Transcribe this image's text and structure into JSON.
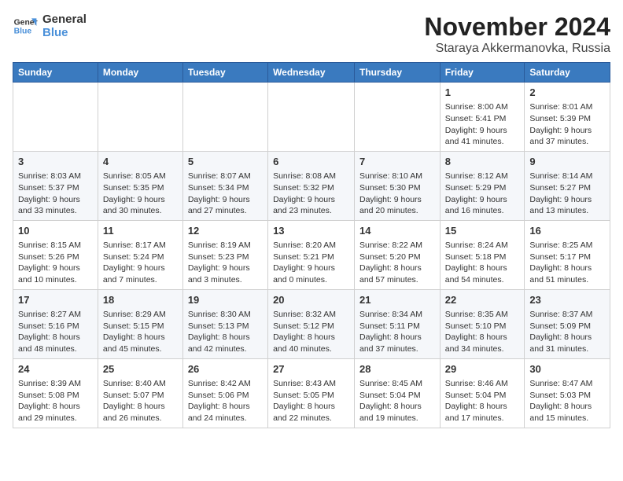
{
  "logo": {
    "line1": "General",
    "line2": "Blue"
  },
  "header": {
    "month": "November 2024",
    "location": "Staraya Akkermanovka, Russia"
  },
  "weekdays": [
    "Sunday",
    "Monday",
    "Tuesday",
    "Wednesday",
    "Thursday",
    "Friday",
    "Saturday"
  ],
  "weeks": [
    [
      {
        "day": "",
        "info": ""
      },
      {
        "day": "",
        "info": ""
      },
      {
        "day": "",
        "info": ""
      },
      {
        "day": "",
        "info": ""
      },
      {
        "day": "",
        "info": ""
      },
      {
        "day": "1",
        "info": "Sunrise: 8:00 AM\nSunset: 5:41 PM\nDaylight: 9 hours\nand 41 minutes."
      },
      {
        "day": "2",
        "info": "Sunrise: 8:01 AM\nSunset: 5:39 PM\nDaylight: 9 hours\nand 37 minutes."
      }
    ],
    [
      {
        "day": "3",
        "info": "Sunrise: 8:03 AM\nSunset: 5:37 PM\nDaylight: 9 hours\nand 33 minutes."
      },
      {
        "day": "4",
        "info": "Sunrise: 8:05 AM\nSunset: 5:35 PM\nDaylight: 9 hours\nand 30 minutes."
      },
      {
        "day": "5",
        "info": "Sunrise: 8:07 AM\nSunset: 5:34 PM\nDaylight: 9 hours\nand 27 minutes."
      },
      {
        "day": "6",
        "info": "Sunrise: 8:08 AM\nSunset: 5:32 PM\nDaylight: 9 hours\nand 23 minutes."
      },
      {
        "day": "7",
        "info": "Sunrise: 8:10 AM\nSunset: 5:30 PM\nDaylight: 9 hours\nand 20 minutes."
      },
      {
        "day": "8",
        "info": "Sunrise: 8:12 AM\nSunset: 5:29 PM\nDaylight: 9 hours\nand 16 minutes."
      },
      {
        "day": "9",
        "info": "Sunrise: 8:14 AM\nSunset: 5:27 PM\nDaylight: 9 hours\nand 13 minutes."
      }
    ],
    [
      {
        "day": "10",
        "info": "Sunrise: 8:15 AM\nSunset: 5:26 PM\nDaylight: 9 hours\nand 10 minutes."
      },
      {
        "day": "11",
        "info": "Sunrise: 8:17 AM\nSunset: 5:24 PM\nDaylight: 9 hours\nand 7 minutes."
      },
      {
        "day": "12",
        "info": "Sunrise: 8:19 AM\nSunset: 5:23 PM\nDaylight: 9 hours\nand 3 minutes."
      },
      {
        "day": "13",
        "info": "Sunrise: 8:20 AM\nSunset: 5:21 PM\nDaylight: 9 hours\nand 0 minutes."
      },
      {
        "day": "14",
        "info": "Sunrise: 8:22 AM\nSunset: 5:20 PM\nDaylight: 8 hours\nand 57 minutes."
      },
      {
        "day": "15",
        "info": "Sunrise: 8:24 AM\nSunset: 5:18 PM\nDaylight: 8 hours\nand 54 minutes."
      },
      {
        "day": "16",
        "info": "Sunrise: 8:25 AM\nSunset: 5:17 PM\nDaylight: 8 hours\nand 51 minutes."
      }
    ],
    [
      {
        "day": "17",
        "info": "Sunrise: 8:27 AM\nSunset: 5:16 PM\nDaylight: 8 hours\nand 48 minutes."
      },
      {
        "day": "18",
        "info": "Sunrise: 8:29 AM\nSunset: 5:15 PM\nDaylight: 8 hours\nand 45 minutes."
      },
      {
        "day": "19",
        "info": "Sunrise: 8:30 AM\nSunset: 5:13 PM\nDaylight: 8 hours\nand 42 minutes."
      },
      {
        "day": "20",
        "info": "Sunrise: 8:32 AM\nSunset: 5:12 PM\nDaylight: 8 hours\nand 40 minutes."
      },
      {
        "day": "21",
        "info": "Sunrise: 8:34 AM\nSunset: 5:11 PM\nDaylight: 8 hours\nand 37 minutes."
      },
      {
        "day": "22",
        "info": "Sunrise: 8:35 AM\nSunset: 5:10 PM\nDaylight: 8 hours\nand 34 minutes."
      },
      {
        "day": "23",
        "info": "Sunrise: 8:37 AM\nSunset: 5:09 PM\nDaylight: 8 hours\nand 31 minutes."
      }
    ],
    [
      {
        "day": "24",
        "info": "Sunrise: 8:39 AM\nSunset: 5:08 PM\nDaylight: 8 hours\nand 29 minutes."
      },
      {
        "day": "25",
        "info": "Sunrise: 8:40 AM\nSunset: 5:07 PM\nDaylight: 8 hours\nand 26 minutes."
      },
      {
        "day": "26",
        "info": "Sunrise: 8:42 AM\nSunset: 5:06 PM\nDaylight: 8 hours\nand 24 minutes."
      },
      {
        "day": "27",
        "info": "Sunrise: 8:43 AM\nSunset: 5:05 PM\nDaylight: 8 hours\nand 22 minutes."
      },
      {
        "day": "28",
        "info": "Sunrise: 8:45 AM\nSunset: 5:04 PM\nDaylight: 8 hours\nand 19 minutes."
      },
      {
        "day": "29",
        "info": "Sunrise: 8:46 AM\nSunset: 5:04 PM\nDaylight: 8 hours\nand 17 minutes."
      },
      {
        "day": "30",
        "info": "Sunrise: 8:47 AM\nSunset: 5:03 PM\nDaylight: 8 hours\nand 15 minutes."
      }
    ]
  ]
}
